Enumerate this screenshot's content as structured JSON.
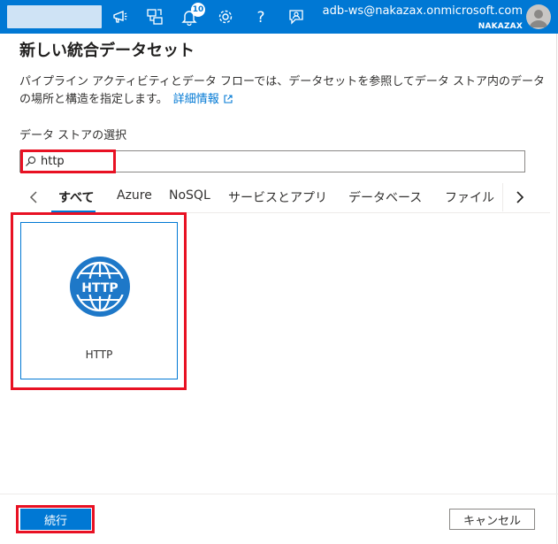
{
  "topbar": {
    "notification_count": "10",
    "account_email": "adb-ws@nakazax.onmicrosoft.com",
    "account_tenant": "NAKAZAX",
    "icons": [
      "feedback-icon",
      "directory-icon",
      "notification-bell-icon",
      "settings-gear-icon",
      "help-icon",
      "support-chat-icon"
    ]
  },
  "dialog": {
    "title": "新しい統合データセット",
    "description": "パイプライン アクティビティとデータ フローでは、データセットを参照してデータ ストア内のデータの場所と構造を指定します。",
    "learn_more": "詳細情報",
    "store_label": "データ ストアの選択",
    "search_value": "http",
    "tabs": [
      "すべて",
      "Azure",
      "NoSQL",
      "サービスとアプリ",
      "データベース",
      "ファイル"
    ],
    "active_tab": "すべて",
    "cards": [
      {
        "label": "HTTP",
        "logo_text": "HTTP"
      }
    ],
    "continue_label": "続行",
    "cancel_label": "キャンセル"
  },
  "colors": {
    "accent": "#0078d4",
    "highlight": "#e81123"
  }
}
